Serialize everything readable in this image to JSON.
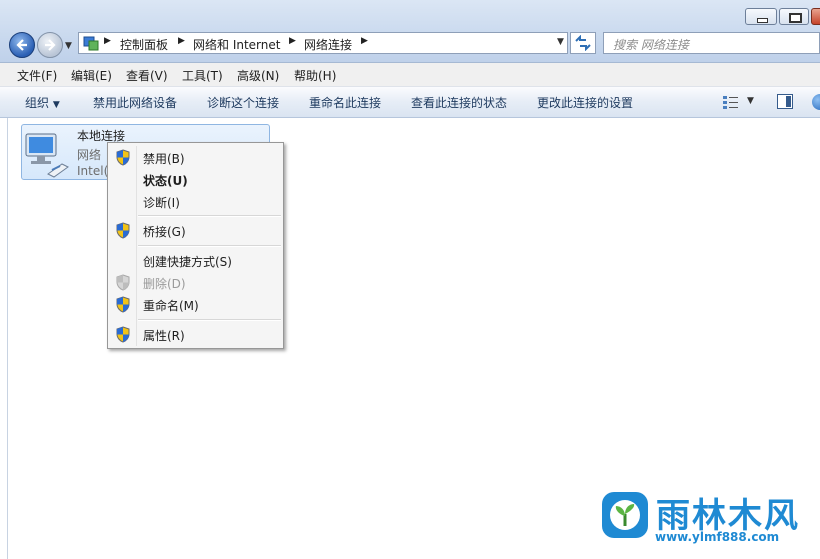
{
  "address": {
    "breadcrumbs": [
      "控制面板",
      "网络和 Internet",
      "网络连接"
    ],
    "search_placeholder": "搜索 网络连接"
  },
  "menu_bar": {
    "items": [
      "文件(F)",
      "编辑(E)",
      "查看(V)",
      "工具(T)",
      "高级(N)",
      "帮助(H)"
    ]
  },
  "command_bar": {
    "organize": "组织",
    "commands": [
      "禁用此网络设备",
      "诊断这个连接",
      "重命名此连接",
      "查看此连接的状态",
      "更改此连接的设置"
    ]
  },
  "connection": {
    "name": "本地连接",
    "status": "网络",
    "device": "Intel("
  },
  "context_menu": {
    "items": [
      {
        "label": "禁用(B)",
        "icon": "uac-shield-icon",
        "style": "normal"
      },
      {
        "label": "状态(U)",
        "icon": "",
        "style": "bold"
      },
      {
        "label": "诊断(I)",
        "icon": "",
        "style": "normal"
      },
      {
        "label": "桥接(G)",
        "icon": "uac-shield-icon",
        "style": "normal"
      },
      {
        "label": "创建快捷方式(S)",
        "icon": "",
        "style": "normal"
      },
      {
        "label": "删除(D)",
        "icon": "uac-shield-icon",
        "style": "disabled"
      },
      {
        "label": "重命名(M)",
        "icon": "uac-shield-icon",
        "style": "normal"
      },
      {
        "label": "属性(R)",
        "icon": "uac-shield-icon",
        "style": "normal"
      }
    ]
  },
  "watermark": {
    "title": "雨林木风",
    "url": "www.ylmf888.com"
  },
  "colors": {
    "accent": "#1f8ad3",
    "selection": "#d6e8fb",
    "command_text": "#1e3a5f"
  }
}
